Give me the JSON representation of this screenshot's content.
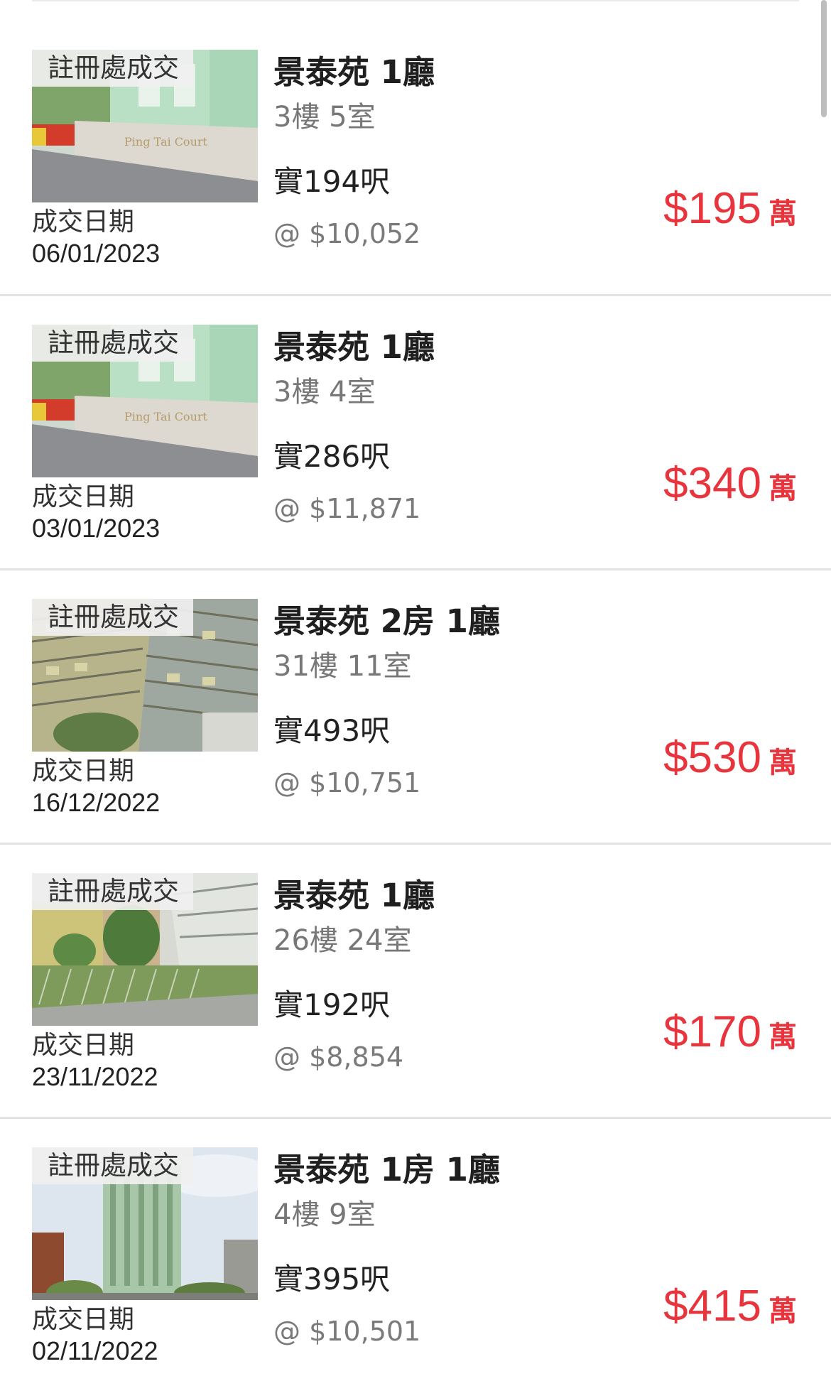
{
  "listings": [
    {
      "badge": "註冊處成交",
      "date_label": "成交日期",
      "date": "06/01/2023",
      "title": "景泰苑 1廳",
      "unit": "3樓 5室",
      "area": "實194呎",
      "psf": "@ $10,052",
      "price": "$195",
      "price_unit": "萬",
      "photo": "estate-sign"
    },
    {
      "badge": "註冊處成交",
      "date_label": "成交日期",
      "date": "03/01/2023",
      "title": "景泰苑 1廳",
      "unit": "3樓 4室",
      "area": "實286呎",
      "psf": "@ $11,871",
      "price": "$340",
      "price_unit": "萬",
      "photo": "estate-sign"
    },
    {
      "badge": "註冊處成交",
      "date_label": "成交日期",
      "date": "16/12/2022",
      "title": "景泰苑 2房 1廳",
      "unit": "31樓 11室",
      "area": "實493呎",
      "psf": "@ $10,751",
      "price": "$530",
      "price_unit": "萬",
      "photo": "tower-closeup"
    },
    {
      "badge": "註冊處成交",
      "date_label": "成交日期",
      "date": "23/11/2022",
      "title": "景泰苑 1廳",
      "unit": "26樓 24室",
      "area": "實192呎",
      "psf": "@ $8,854",
      "price": "$170",
      "price_unit": "萬",
      "photo": "garden"
    },
    {
      "badge": "註冊處成交",
      "date_label": "成交日期",
      "date": "02/11/2022",
      "title": "景泰苑 1房 1廳",
      "unit": "4樓 9室",
      "area": "實395呎",
      "psf": "@ $10,501",
      "price": "$415",
      "price_unit": "萬",
      "photo": "tower-sky"
    }
  ],
  "colors": {
    "price": "#e8343c",
    "divider": "#e3e3e3",
    "badge_bg": "#f0f0f0"
  }
}
